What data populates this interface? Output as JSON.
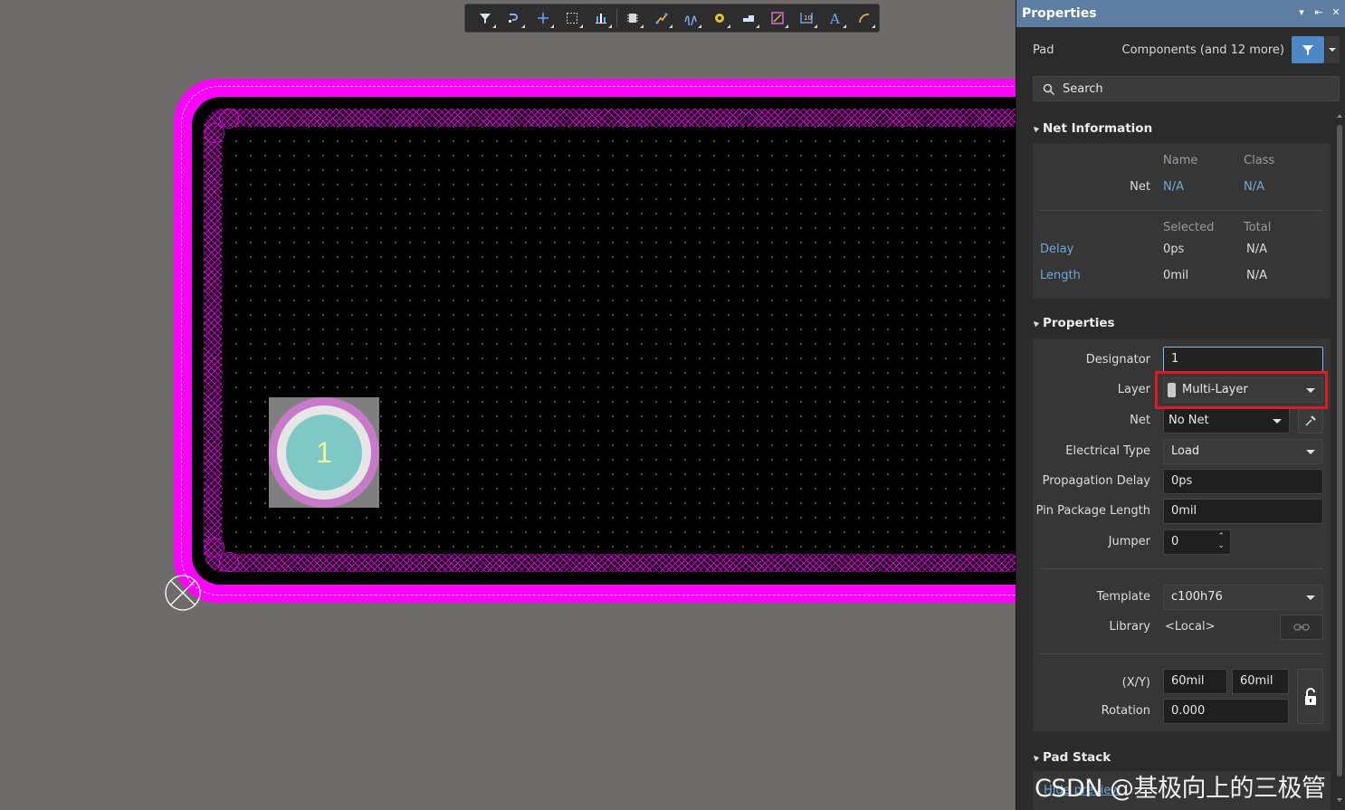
{
  "toolbar": {
    "buttons": [
      "filter-icon",
      "route-icon",
      "place-cross-icon",
      "select-rect-icon",
      "align-icon",
      "component-icon",
      "interactive-route-icon",
      "diff-pair-icon",
      "via-icon",
      "fill-icon",
      "region-icon",
      "dimension-icon",
      "text-icon",
      "arc-icon"
    ]
  },
  "canvas": {
    "pad_designator": "1"
  },
  "panel": {
    "title": "Properties",
    "controls": [
      "▾",
      "⇤",
      "✕"
    ],
    "object_type": "Pad",
    "selection_scope": "Components (and 12 more)",
    "search_placeholder": "Search",
    "net_info": {
      "header": "Net Information",
      "col_name": "Name",
      "col_class": "Class",
      "net_label": "Net",
      "net_name": "N/A",
      "net_class": "N/A",
      "col_selected": "Selected",
      "col_total": "Total",
      "delay_label": "Delay",
      "delay_selected": "0ps",
      "delay_total": "N/A",
      "length_label": "Length",
      "length_selected": "0mil",
      "length_total": "N/A"
    },
    "properties": {
      "header": "Properties",
      "designator_label": "Designator",
      "designator_value": "1",
      "layer_label": "Layer",
      "layer_value": "Multi-Layer",
      "net_label": "Net",
      "net_value": "No Net",
      "electrical_type_label": "Electrical Type",
      "electrical_type_value": "Load",
      "propagation_delay_label": "Propagation Delay",
      "propagation_delay_value": "0ps",
      "pin_package_length_label": "Pin Package Length",
      "pin_package_length_value": "0mil",
      "jumper_label": "Jumper",
      "jumper_value": "0",
      "template_label": "Template",
      "template_value": "c100h76",
      "library_label": "Library",
      "library_value": "<Local>",
      "xy_label": "(X/Y)",
      "x_value": "60mil",
      "y_value": "60mil",
      "rotation_label": "Rotation",
      "rotation_value": "0.000"
    },
    "pad_stack": {
      "header": "Pad Stack",
      "preview_link": "Hide preview"
    }
  },
  "watermark": "CSDN @基极向上的三极管",
  "colors": {
    "board_outline": "#ff00ff",
    "panel_title_bg": "#5d7ea1",
    "accent_blue": "#4d88c6",
    "link": "#6fa8dc",
    "highlight": "#e01a22",
    "pad_ring": "#c77ac8",
    "pad_core": "#7ec8c6"
  }
}
